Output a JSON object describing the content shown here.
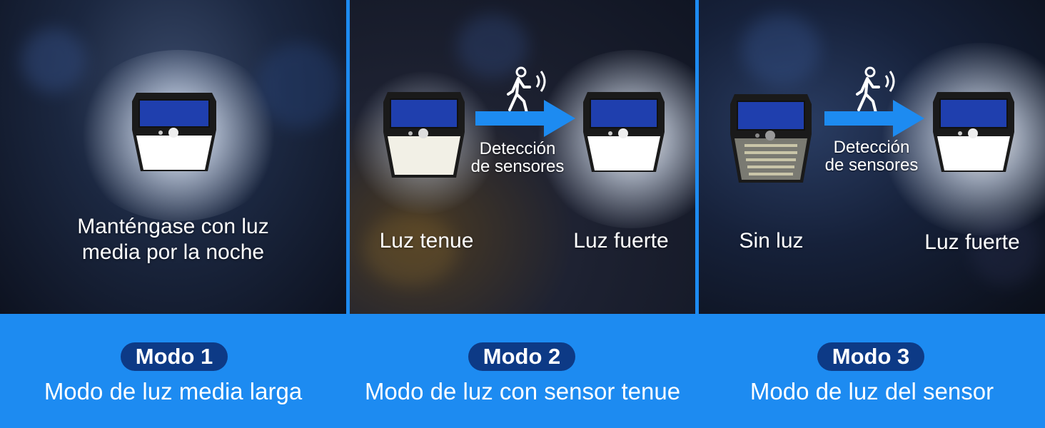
{
  "panels": [
    {
      "caption": "Manténgase con luz media por la noche",
      "caption_lines": [
        "Manténgase con luz",
        "media por la noche"
      ]
    },
    {
      "left_caption": "Luz tenue",
      "arrow_label_lines": [
        "Detección",
        "de sensores"
      ],
      "right_caption": "Luz fuerte"
    },
    {
      "left_caption": "Sin luz",
      "arrow_label_lines": [
        "Detección",
        "de sensores"
      ],
      "right_caption": "Luz fuerte"
    }
  ],
  "modes": [
    {
      "badge": "Modo 1",
      "description": "Modo de luz media larga"
    },
    {
      "badge": "Modo 2",
      "description": "Modo de luz con sensor tenue"
    },
    {
      "badge": "Modo 3",
      "description": "Modo de luz del sensor"
    }
  ],
  "colors": {
    "accent_blue": "#1d8bf1",
    "badge_navy": "#0d3a86",
    "arrow_blue": "#1d8bf1"
  },
  "icons": [
    "walking-person-icon",
    "motion-waves-icon",
    "right-arrow-icon",
    "solar-lamp-icon"
  ]
}
